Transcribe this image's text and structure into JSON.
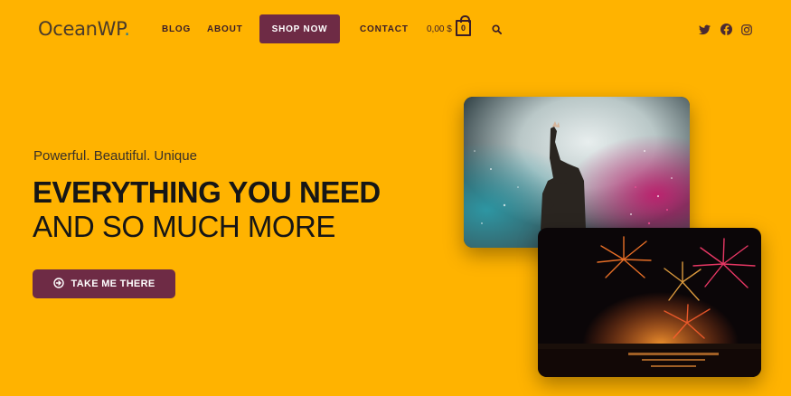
{
  "header": {
    "logo_text": "OceanWP",
    "logo_dot": ".",
    "nav": {
      "blog": "BLOG",
      "about": "ABOUT",
      "shop_now": "SHOP NOW",
      "contact": "CONTACT"
    },
    "cart": {
      "total": "0,00 $",
      "count": "0"
    },
    "icons": [
      "search-icon",
      "twitter-icon",
      "facebook-icon",
      "instagram-icon"
    ]
  },
  "hero": {
    "tagline": "Powerful. Beautiful. Unique",
    "headline_bold": "EVERYTHING YOU NEED",
    "headline_light": "AND SO MUCH MORE",
    "cta_label": "TAKE ME THERE"
  },
  "colors": {
    "background": "#FFB300",
    "accent": "#6E2B45",
    "text": "#161616"
  }
}
